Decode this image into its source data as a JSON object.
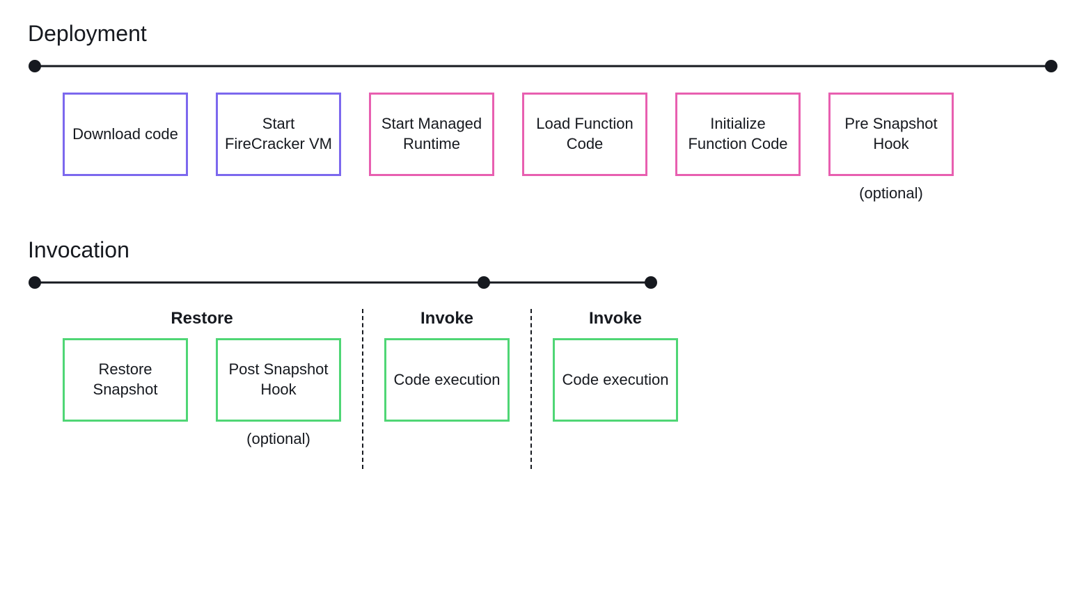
{
  "deployment": {
    "title": "Deployment",
    "steps": [
      {
        "label": "Download code",
        "color": "purple"
      },
      {
        "label": "Start FireCracker VM",
        "color": "purple"
      },
      {
        "label": "Start Managed Runtime",
        "color": "pink"
      },
      {
        "label": "Load Function Code",
        "color": "pink"
      },
      {
        "label": "Initialize Function Code",
        "color": "pink"
      },
      {
        "label": "Pre Snapshot Hook",
        "color": "pink",
        "sub": "(optional)"
      }
    ]
  },
  "invocation": {
    "title": "Invocation",
    "phases": [
      {
        "label": "Restore",
        "steps": [
          {
            "label": "Restore Snapshot",
            "color": "green"
          },
          {
            "label": "Post Snapshot Hook",
            "color": "green",
            "sub": "(optional)"
          }
        ]
      },
      {
        "label": "Invoke",
        "steps": [
          {
            "label": "Code execution",
            "color": "green"
          }
        ]
      },
      {
        "label": "Invoke",
        "steps": [
          {
            "label": "Code execution",
            "color": "green"
          }
        ]
      }
    ]
  }
}
